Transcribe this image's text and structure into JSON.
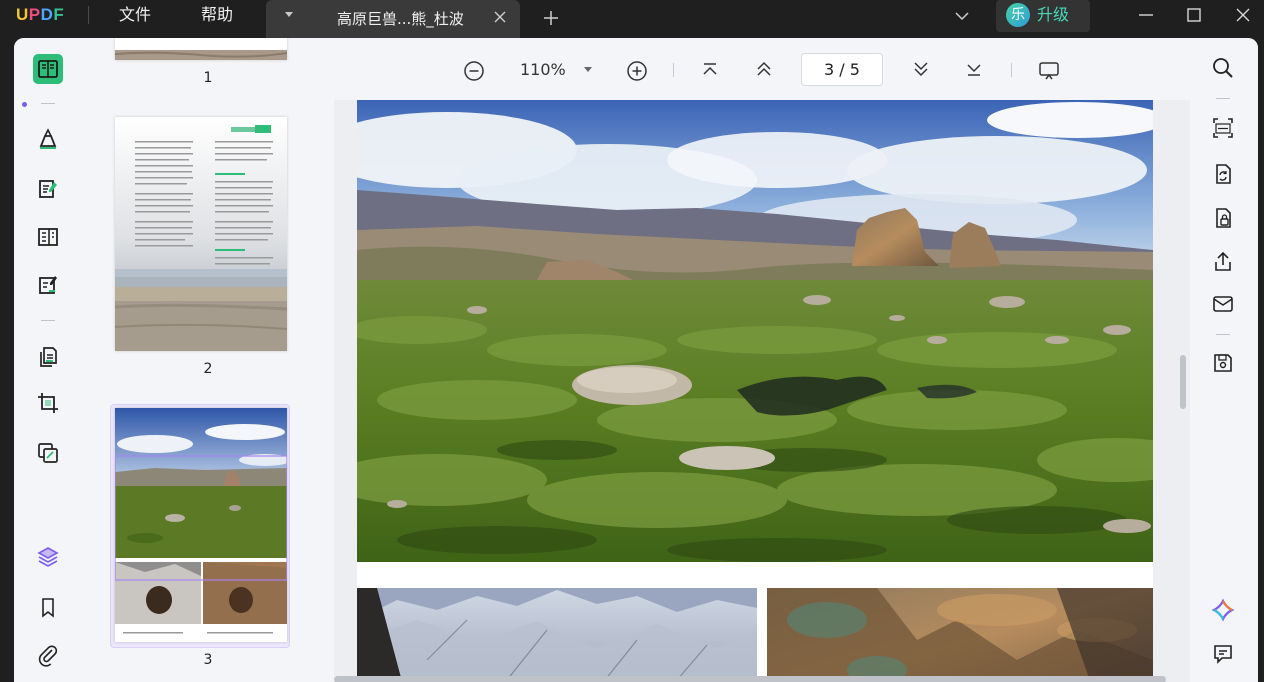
{
  "app": {
    "logo": {
      "u": "U",
      "p": "P",
      "d": "D",
      "f": "F"
    },
    "menu": {
      "file": "文件",
      "help": "帮助"
    }
  },
  "tab": {
    "title": "高原巨兽...熊_杜波"
  },
  "upgrade": {
    "avatar_char": "乐",
    "label": "升级"
  },
  "toolbar": {
    "zoom": "110%",
    "page": {
      "current": "3",
      "separator": "/",
      "total": "5"
    }
  },
  "thumbnails": [
    {
      "number": "1"
    },
    {
      "number": "2"
    },
    {
      "number": "3"
    }
  ],
  "colors": {
    "accent_green": "#2dbd78",
    "accent_purple": "#7a5cf0",
    "upgrade_text": "#4ad7b8",
    "logo_u": "#f2c530",
    "logo_p": "#ef4d7c",
    "logo_d": "#4fa6ff",
    "logo_f": "#34c38f"
  },
  "icons": {
    "left": [
      "reader-icon",
      "highlighter-icon",
      "edit-pdf-icon",
      "form-icon",
      "fill-sign-icon",
      "organize-pages-icon",
      "crop-icon",
      "compare-icon",
      "layers-icon",
      "bookmark-icon",
      "attachment-icon"
    ],
    "right": [
      "search-icon",
      "ocr-icon",
      "convert-icon",
      "protect-icon",
      "share-icon",
      "email-icon",
      "save-icon",
      "ai-assistant-icon",
      "comment-icon"
    ]
  }
}
